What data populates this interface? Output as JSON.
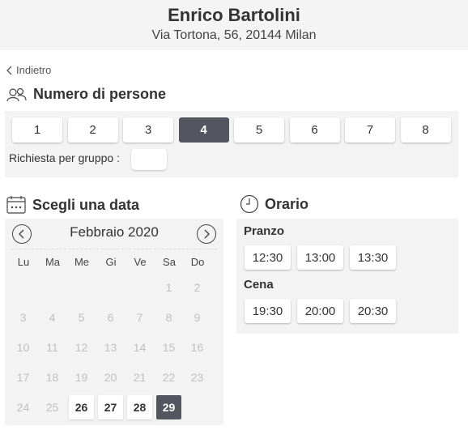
{
  "restaurant": {
    "name": "Enrico Bartolini",
    "address": "Via Tortona, 56, 20144 Milan"
  },
  "back_label": "Indietro",
  "people": {
    "title": "Numero di persone",
    "icon": "people-icon",
    "options": [
      "1",
      "2",
      "3",
      "4",
      "5",
      "6",
      "7",
      "8"
    ],
    "selected": "4",
    "group_label": "Richiesta per gruppo :",
    "group_value": ""
  },
  "calendar": {
    "title": "Scegli una data",
    "icon": "calendar-icon",
    "month": "Febbraio 2020",
    "weekdays": [
      "Lu",
      "Ma",
      "Me",
      "Gi",
      "Ve",
      "Sa",
      "Do"
    ],
    "rows": [
      [
        "",
        "",
        "",
        "",
        "",
        "1",
        "2"
      ],
      [
        "3",
        "4",
        "5",
        "6",
        "7",
        "8",
        "9"
      ],
      [
        "10",
        "11",
        "12",
        "13",
        "14",
        "15",
        "16"
      ],
      [
        "17",
        "18",
        "19",
        "20",
        "21",
        "22",
        "23"
      ],
      [
        "24",
        "25",
        "26",
        "27",
        "28",
        "29",
        ""
      ]
    ],
    "available": [
      "26",
      "27",
      "28"
    ],
    "selected": "29"
  },
  "time": {
    "title": "Orario",
    "icon": "clock-icon",
    "lunch": {
      "label": "Pranzo",
      "slots": [
        "12:30",
        "13:00",
        "13:30"
      ]
    },
    "dinner": {
      "label": "Cena",
      "slots": [
        "19:30",
        "20:00",
        "20:30"
      ]
    }
  },
  "colors": {
    "selected": "#54555e",
    "panel": "#f3f3f3",
    "header": "#f4f4f4",
    "disabled": "#bfbfbf"
  }
}
